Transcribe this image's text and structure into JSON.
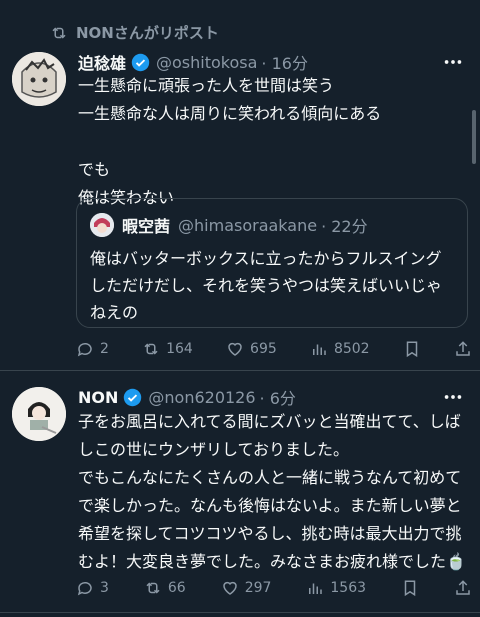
{
  "repost": {
    "label": "NONさんがリポスト"
  },
  "tweet1": {
    "name": "迫稔雄",
    "handle": "@oshitokosa",
    "time": "· 16分",
    "text": "一生懸命に頑張った人を世間は笑う\n一生懸命な人は周りに笑われる傾向にある\n\nでも\n俺は笑わない",
    "quote": {
      "name": "暇空茜",
      "handle": "@himasoraakane",
      "time": "· 22分",
      "text": "俺はバッターボックスに立ったからフルスイングしただけだし、それを笑うやつは笑えばいいじゃねえの"
    },
    "replies": "2",
    "reposts": "164",
    "likes": "695",
    "views": "8502"
  },
  "tweet2": {
    "name": "NON",
    "handle": "@non620126",
    "time": "· 6分",
    "text": "子をお風呂に入れてる間にズバッと当確出てて、しばしこの世にウンザリしておりました。\nでもこんなにたくさんの人と一緒に戦うなんて初めてで楽しかった。なんも後悔はないよ。また新しい夢と希望を探してコツコツやるし、挑む時は最大出力で挑むよ！大変良き夢でした。みなさまお疲れ様でした",
    "emoji": "🍵",
    "replies": "3",
    "reposts": "66",
    "likes": "297",
    "views": "1563"
  },
  "colors": {
    "background": "#15202b",
    "muted": "#8b98a5",
    "verified": "#1d9bf0",
    "border": "#38444d"
  }
}
